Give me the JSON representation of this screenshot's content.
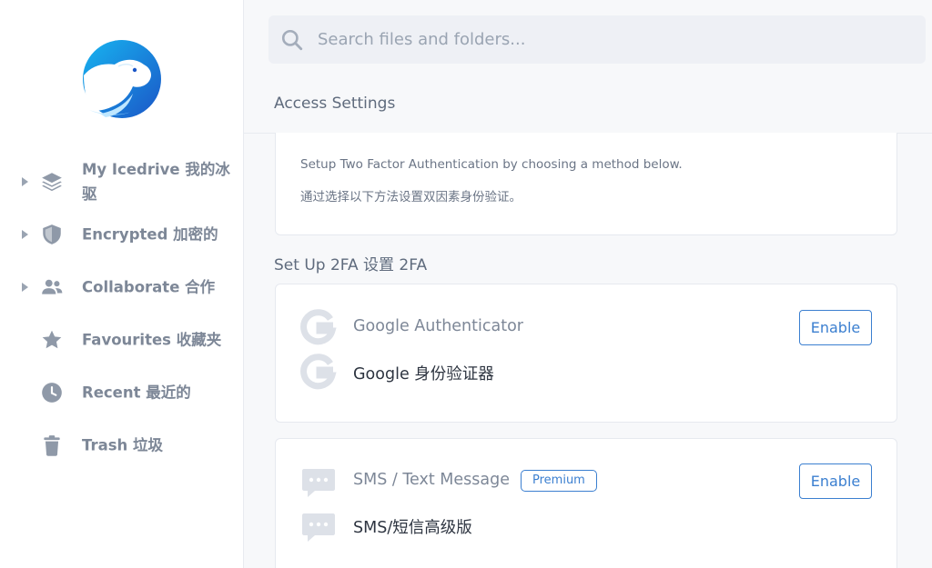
{
  "sidebar": {
    "items": [
      {
        "label": "My Icedrive 我的冰驱",
        "icon": "layers-icon",
        "expandable": true
      },
      {
        "label": "Encrypted 加密的",
        "icon": "shield-icon",
        "expandable": true
      },
      {
        "label": "Collaborate  合作",
        "icon": "users-icon",
        "expandable": true
      },
      {
        "label": "Favourites 收藏夹",
        "icon": "star-icon",
        "expandable": false
      },
      {
        "label": "Recent 最近的",
        "icon": "clock-icon",
        "expandable": false
      },
      {
        "label": "Trash 垃圾",
        "icon": "trash-icon",
        "expandable": false
      }
    ]
  },
  "search": {
    "placeholder": "Search files and folders..."
  },
  "main": {
    "page_title": "Access Settings",
    "info": {
      "line1": "Setup Two Factor Authentication by choosing a method below.",
      "line2": "通过选择以下方法设置双因素身份验证。"
    },
    "section_title": "Set Up 2FA 设置 2FA",
    "methods": [
      {
        "title": "Google Authenticator",
        "subtitle": "Google 身份验证器",
        "button": "Enable",
        "icon": "google-icon"
      },
      {
        "title": "SMS / Text Message",
        "subtitle": "SMS/短信高级版",
        "badge": "Premium",
        "button": "Enable",
        "icon": "chat-bubble-icon"
      }
    ]
  },
  "colors": {
    "accent": "#3b7fd0",
    "text": "#5f6b7d",
    "muted": "#9aa4b2",
    "background": "#f7f8fa"
  }
}
